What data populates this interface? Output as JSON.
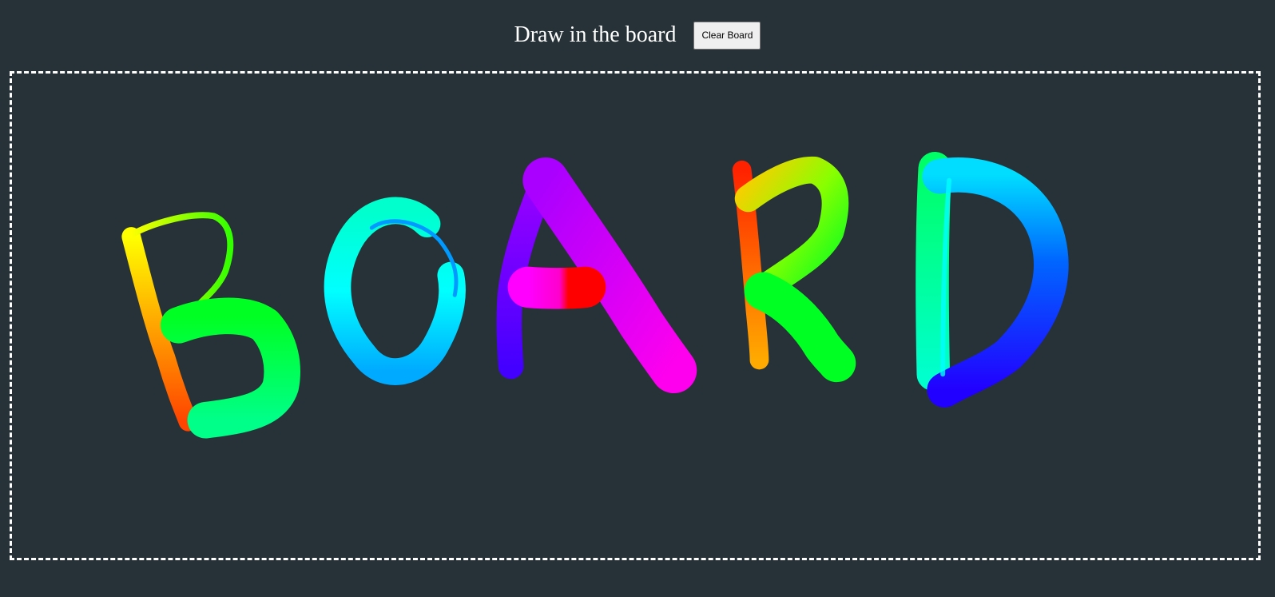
{
  "header": {
    "title": "Draw in the board",
    "clear_button_label": "Clear Board"
  },
  "board": {
    "drawing": "BOARD",
    "colors": {
      "background": "#263238",
      "border": "#ffffff"
    }
  }
}
